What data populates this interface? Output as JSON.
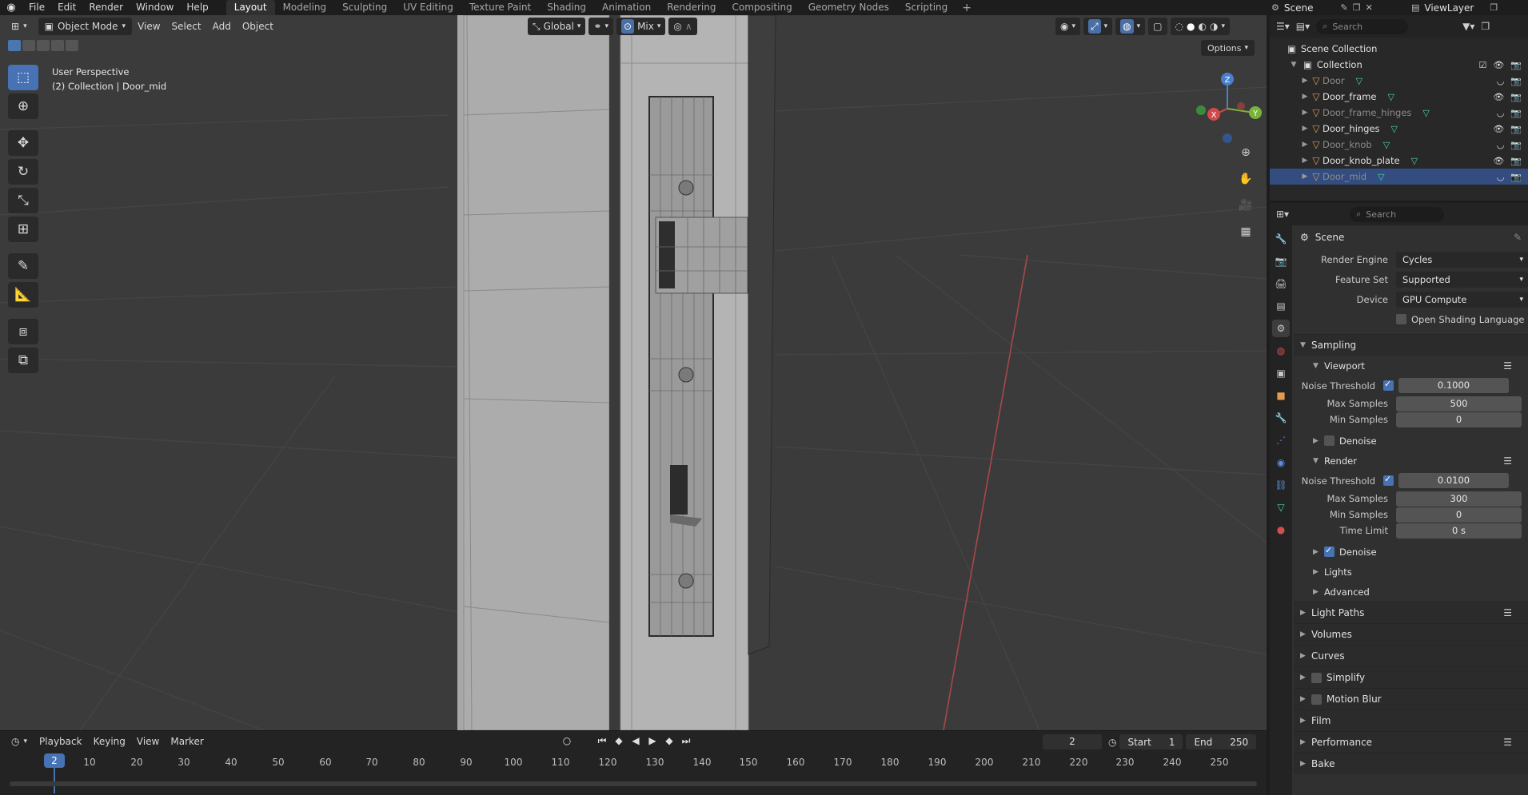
{
  "menu": {
    "items": [
      "File",
      "Edit",
      "Render",
      "Window",
      "Help"
    ],
    "workspaces": [
      "Layout",
      "Modeling",
      "Sculpting",
      "UV Editing",
      "Texture Paint",
      "Shading",
      "Animation",
      "Rendering",
      "Compositing",
      "Geometry Nodes",
      "Scripting"
    ],
    "active_workspace": "Layout",
    "scene": "Scene",
    "view_layer": "ViewLayer"
  },
  "viewport": {
    "mode": "Object Mode",
    "menus": [
      "View",
      "Select",
      "Add",
      "Object"
    ],
    "orientation": "Global",
    "snap_mode": "Mix",
    "options_label": "Options",
    "info_line1": "User Perspective",
    "info_line2": "(2) Collection | Door_mid",
    "gizmo": {
      "x": "X",
      "y": "Y",
      "z": "Z"
    }
  },
  "timeline": {
    "menus": [
      "Playback",
      "Keying",
      "View",
      "Marker"
    ],
    "current_frame": "2",
    "start_label": "Start",
    "start_value": "1",
    "end_label": "End",
    "end_value": "250",
    "ticks": [
      "10",
      "20",
      "30",
      "40",
      "50",
      "60",
      "70",
      "80",
      "90",
      "100",
      "110",
      "120",
      "130",
      "140",
      "150",
      "160",
      "170",
      "180",
      "190",
      "200",
      "210",
      "220",
      "230",
      "240",
      "250"
    ],
    "playhead_label": "2"
  },
  "outliner": {
    "search_placeholder": "Search",
    "root": "Scene Collection",
    "collection": "Collection",
    "objects": [
      {
        "name": "Door",
        "dim": true,
        "selected": false
      },
      {
        "name": "Door_frame",
        "dim": false,
        "selected": false
      },
      {
        "name": "Door_frame_hinges",
        "dim": true,
        "selected": false
      },
      {
        "name": "Door_hinges",
        "dim": false,
        "selected": false
      },
      {
        "name": "Door_knob",
        "dim": true,
        "selected": false
      },
      {
        "name": "Door_knob_plate",
        "dim": false,
        "selected": false
      },
      {
        "name": "Door_mid",
        "dim": true,
        "selected": true
      }
    ]
  },
  "properties": {
    "search_placeholder": "Search",
    "context": "Scene",
    "render_engine_label": "Render Engine",
    "render_engine": "Cycles",
    "feature_set_label": "Feature Set",
    "feature_set": "Supported",
    "device_label": "Device",
    "device": "GPU Compute",
    "osl_label": "Open Shading Language",
    "sampling": "Sampling",
    "viewport_sub": "Viewport",
    "noise_threshold_label": "Noise Threshold",
    "viewport_noise_threshold": "0.1000",
    "max_samples_label": "Max Samples",
    "viewport_max_samples": "500",
    "min_samples_label": "Min Samples",
    "viewport_min_samples": "0",
    "denoise_label": "Denoise",
    "render_sub": "Render",
    "render_noise_threshold": "0.0100",
    "render_max_samples": "300",
    "render_min_samples": "0",
    "time_limit_label": "Time Limit",
    "time_limit": "0 s",
    "lights": "Lights",
    "advanced": "Advanced",
    "sections": [
      "Light Paths",
      "Volumes",
      "Curves",
      "Simplify",
      "Motion Blur",
      "Film",
      "Performance",
      "Bake"
    ]
  }
}
